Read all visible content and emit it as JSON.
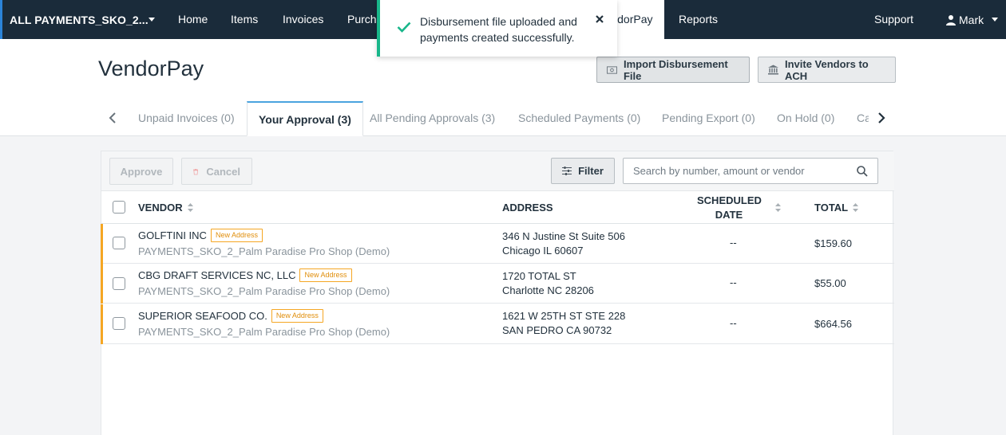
{
  "nav": {
    "org_name": "ALL PAYMENTS_SKO_2...",
    "items": [
      "Home",
      "Items",
      "Invoices",
      "Purch...",
      "VendorPay",
      "Reports"
    ],
    "support": "Support",
    "user": "Mark",
    "colors": {
      "nav_bg": "#1a2b3a",
      "accent": "#2b84d9"
    }
  },
  "toast": {
    "message_line1": "Disbursement file uploaded and",
    "message_line2": "payments created successfully.",
    "close_icon": "close-icon",
    "status_color": "#18b68a"
  },
  "header": {
    "title": "VendorPay",
    "import_button": "Import Disbursement File",
    "invite_button": "Invite Vendors to ACH"
  },
  "tabs": {
    "items": [
      "Unpaid Invoices (0)",
      "Your Approval (3)",
      "All Pending Approvals (3)",
      "Scheduled Payments (0)",
      "Pending Export (0)",
      "On Hold (0)",
      "Ca"
    ],
    "active_index": 1
  },
  "toolbar": {
    "approve_label": "Approve",
    "cancel_label": "Cancel",
    "filter_label": "Filter",
    "search_placeholder": "Search by number, amount or vendor"
  },
  "table": {
    "columns": {
      "vendor": "VENDOR",
      "address": "ADDRESS",
      "scheduled_line1": "SCHEDULED",
      "scheduled_line2": "DATE",
      "total": "TOTAL"
    },
    "rows": [
      {
        "vendor": "GOLFTINI INC",
        "badge": "New Address",
        "location": "PAYMENTS_SKO_2_Palm Paradise Pro Shop (Demo)",
        "address1": "346 N Justine St Suite 506",
        "address2": "Chicago IL 60607",
        "scheduled": "--",
        "total": "$159.60"
      },
      {
        "vendor": "CBG DRAFT SERVICES NC, LLC",
        "badge": "New Address",
        "location": "PAYMENTS_SKO_2_Palm Paradise Pro Shop (Demo)",
        "address1": "1720 TOTAL ST",
        "address2": "Charlotte NC 28206",
        "scheduled": "--",
        "total": "$55.00"
      },
      {
        "vendor": "SUPERIOR SEAFOOD CO.",
        "badge": "New Address",
        "location": "PAYMENTS_SKO_2_Palm Paradise Pro Shop (Demo)",
        "address1": "1621 W 25TH ST STE 228",
        "address2": "SAN PEDRO CA 90732",
        "scheduled": "--",
        "total": "$664.56"
      }
    ],
    "row_accent_color": "#f5a623"
  }
}
